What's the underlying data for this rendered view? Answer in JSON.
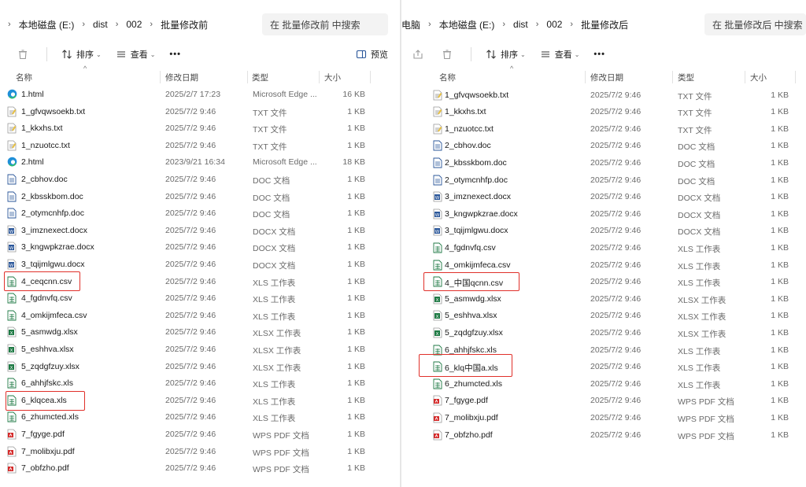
{
  "left": {
    "breadcrumb": [
      "本地磁盘 (E:)",
      "dist",
      "002",
      "批量修改前"
    ],
    "search_placeholder": "在 批量修改前 中搜索",
    "toolbar": {
      "sort": "排序",
      "view": "查看",
      "more": "•••",
      "preview": "预览"
    },
    "headers": {
      "name": "名称",
      "date": "修改日期",
      "type": "类型",
      "size": "大小"
    },
    "files": [
      {
        "name": "1.html",
        "date": "2025/2/7 17:23",
        "type": "Microsoft Edge ...",
        "size": "16 KB",
        "icon": "edge"
      },
      {
        "name": "1_gfvqwsoekb.txt",
        "date": "2025/7/2 9:46",
        "type": "TXT 文件",
        "size": "1 KB",
        "icon": "txt"
      },
      {
        "name": "1_kkxhs.txt",
        "date": "2025/7/2 9:46",
        "type": "TXT 文件",
        "size": "1 KB",
        "icon": "txt"
      },
      {
        "name": "1_nzuotcc.txt",
        "date": "2025/7/2 9:46",
        "type": "TXT 文件",
        "size": "1 KB",
        "icon": "txt"
      },
      {
        "name": "2.html",
        "date": "2023/9/21 16:34",
        "type": "Microsoft Edge ...",
        "size": "18 KB",
        "icon": "edge"
      },
      {
        "name": "2_cbhov.doc",
        "date": "2025/7/2 9:46",
        "type": "DOC 文档",
        "size": "1 KB",
        "icon": "doc"
      },
      {
        "name": "2_kbsskbom.doc",
        "date": "2025/7/2 9:46",
        "type": "DOC 文档",
        "size": "1 KB",
        "icon": "doc"
      },
      {
        "name": "2_otymcnhfp.doc",
        "date": "2025/7/2 9:46",
        "type": "DOC 文档",
        "size": "1 KB",
        "icon": "doc"
      },
      {
        "name": "3_imznexect.docx",
        "date": "2025/7/2 9:46",
        "type": "DOCX 文档",
        "size": "1 KB",
        "icon": "docx"
      },
      {
        "name": "3_kngwpkzrae.docx",
        "date": "2025/7/2 9:46",
        "type": "DOCX 文档",
        "size": "1 KB",
        "icon": "docx"
      },
      {
        "name": "3_tqijmlgwu.docx",
        "date": "2025/7/2 9:46",
        "type": "DOCX 文档",
        "size": "1 KB",
        "icon": "docx"
      },
      {
        "name": "4_ceqcnn.csv",
        "date": "2025/7/2 9:46",
        "type": "XLS 工作表",
        "size": "1 KB",
        "icon": "xls"
      },
      {
        "name": "4_fgdnvfq.csv",
        "date": "2025/7/2 9:46",
        "type": "XLS 工作表",
        "size": "1 KB",
        "icon": "xls"
      },
      {
        "name": "4_omkijmfeca.csv",
        "date": "2025/7/2 9:46",
        "type": "XLS 工作表",
        "size": "1 KB",
        "icon": "xls"
      },
      {
        "name": "5_asmwdg.xlsx",
        "date": "2025/7/2 9:46",
        "type": "XLSX 工作表",
        "size": "1 KB",
        "icon": "xlsx"
      },
      {
        "name": "5_eshhva.xlsx",
        "date": "2025/7/2 9:46",
        "type": "XLSX 工作表",
        "size": "1 KB",
        "icon": "xlsx"
      },
      {
        "name": "5_zqdgfzuy.xlsx",
        "date": "2025/7/2 9:46",
        "type": "XLSX 工作表",
        "size": "1 KB",
        "icon": "xlsx"
      },
      {
        "name": "6_ahhjfskc.xls",
        "date": "2025/7/2 9:46",
        "type": "XLS 工作表",
        "size": "1 KB",
        "icon": "xls"
      },
      {
        "name": "6_klqcea.xls",
        "date": "2025/7/2 9:46",
        "type": "XLS 工作表",
        "size": "1 KB",
        "icon": "xls"
      },
      {
        "name": "6_zhumcted.xls",
        "date": "2025/7/2 9:46",
        "type": "XLS 工作表",
        "size": "1 KB",
        "icon": "xls"
      },
      {
        "name": "7_fgyge.pdf",
        "date": "2025/7/2 9:46",
        "type": "WPS PDF 文档",
        "size": "1 KB",
        "icon": "pdf"
      },
      {
        "name": "7_molibxju.pdf",
        "date": "2025/7/2 9:46",
        "type": "WPS PDF 文档",
        "size": "1 KB",
        "icon": "pdf"
      },
      {
        "name": "7_obfzho.pdf",
        "date": "2025/7/2 9:46",
        "type": "WPS PDF 文档",
        "size": "1 KB",
        "icon": "pdf"
      }
    ]
  },
  "right": {
    "breadcrumb": [
      "电脑",
      "本地磁盘 (E:)",
      "dist",
      "002",
      "批量修改后"
    ],
    "search_placeholder": "在 批量修改后 中搜索",
    "toolbar": {
      "sort": "排序",
      "view": "查看",
      "more": "•••"
    },
    "headers": {
      "name": "名称",
      "date": "修改日期",
      "type": "类型",
      "size": "大小"
    },
    "files": [
      {
        "name": "1_gfvqwsoekb.txt",
        "date": "2025/7/2 9:46",
        "type": "TXT 文件",
        "size": "1 KB",
        "icon": "txt"
      },
      {
        "name": "1_kkxhs.txt",
        "date": "2025/7/2 9:46",
        "type": "TXT 文件",
        "size": "1 KB",
        "icon": "txt"
      },
      {
        "name": "1_nzuotcc.txt",
        "date": "2025/7/2 9:46",
        "type": "TXT 文件",
        "size": "1 KB",
        "icon": "txt"
      },
      {
        "name": "2_cbhov.doc",
        "date": "2025/7/2 9:46",
        "type": "DOC 文档",
        "size": "1 KB",
        "icon": "doc"
      },
      {
        "name": "2_kbsskbom.doc",
        "date": "2025/7/2 9:46",
        "type": "DOC 文档",
        "size": "1 KB",
        "icon": "doc"
      },
      {
        "name": "2_otymcnhfp.doc",
        "date": "2025/7/2 9:46",
        "type": "DOC 文档",
        "size": "1 KB",
        "icon": "doc"
      },
      {
        "name": "3_imznexect.docx",
        "date": "2025/7/2 9:46",
        "type": "DOCX 文档",
        "size": "1 KB",
        "icon": "docx"
      },
      {
        "name": "3_kngwpkzrae.docx",
        "date": "2025/7/2 9:46",
        "type": "DOCX 文档",
        "size": "1 KB",
        "icon": "docx"
      },
      {
        "name": "3_tqijmlgwu.docx",
        "date": "2025/7/2 9:46",
        "type": "DOCX 文档",
        "size": "1 KB",
        "icon": "docx"
      },
      {
        "name": "4_fgdnvfq.csv",
        "date": "2025/7/2 9:46",
        "type": "XLS 工作表",
        "size": "1 KB",
        "icon": "xls"
      },
      {
        "name": "4_omkijmfeca.csv",
        "date": "2025/7/2 9:46",
        "type": "XLS 工作表",
        "size": "1 KB",
        "icon": "xls"
      },
      {
        "name": "4_中国qcnn.csv",
        "date": "2025/7/2 9:46",
        "type": "XLS 工作表",
        "size": "1 KB",
        "icon": "xls"
      },
      {
        "name": "5_asmwdg.xlsx",
        "date": "2025/7/2 9:46",
        "type": "XLSX 工作表",
        "size": "1 KB",
        "icon": "xlsx"
      },
      {
        "name": "5_eshhva.xlsx",
        "date": "2025/7/2 9:46",
        "type": "XLSX 工作表",
        "size": "1 KB",
        "icon": "xlsx"
      },
      {
        "name": "5_zqdgfzuy.xlsx",
        "date": "2025/7/2 9:46",
        "type": "XLSX 工作表",
        "size": "1 KB",
        "icon": "xlsx"
      },
      {
        "name": "6_ahhjfskc.xls",
        "date": "2025/7/2 9:46",
        "type": "XLS 工作表",
        "size": "1 KB",
        "icon": "xls"
      },
      {
        "name": "6_klq中国a.xls",
        "date": "2025/7/2 9:46",
        "type": "XLS 工作表",
        "size": "1 KB",
        "icon": "xls"
      },
      {
        "name": "6_zhumcted.xls",
        "date": "2025/7/2 9:46",
        "type": "XLS 工作表",
        "size": "1 KB",
        "icon": "xls"
      },
      {
        "name": "7_fgyge.pdf",
        "date": "2025/7/2 9:46",
        "type": "WPS PDF 文档",
        "size": "1 KB",
        "icon": "pdf"
      },
      {
        "name": "7_molibxju.pdf",
        "date": "2025/7/2 9:46",
        "type": "WPS PDF 文档",
        "size": "1 KB",
        "icon": "pdf"
      },
      {
        "name": "7_obfzho.pdf",
        "date": "2025/7/2 9:46",
        "type": "WPS PDF 文档",
        "size": "1 KB",
        "icon": "pdf"
      }
    ]
  },
  "colors": {
    "highlight_box": "#e0302a",
    "edge": "#1f8fd8",
    "word": "#2b579a",
    "excel": "#1f7a45",
    "pdf": "#d42b2b",
    "txt": "#e8c040"
  }
}
